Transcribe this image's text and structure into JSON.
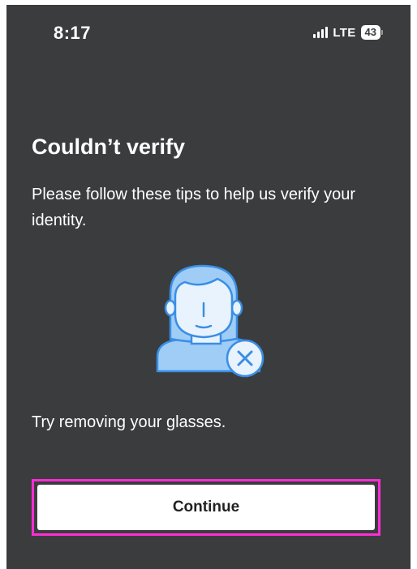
{
  "status_bar": {
    "time": "8:17",
    "network": "LTE",
    "battery": "43",
    "signal_icon": "signal-bars-icon",
    "battery_icon": "battery-icon"
  },
  "screen": {
    "title": "Couldn’t verify",
    "subtitle": "Please follow these tips to help us verify your identity.",
    "illustration_icon": "face-not-verified-icon",
    "tip": "Try removing your glasses."
  },
  "actions": {
    "continue_label": "Continue"
  },
  "colors": {
    "background": "#3b3c3d",
    "illustration_fill": "#9fcdf6",
    "illustration_stroke": "#3a8ee6",
    "button_bg": "#ffffff",
    "focus_outline": "#ff2dd6"
  }
}
